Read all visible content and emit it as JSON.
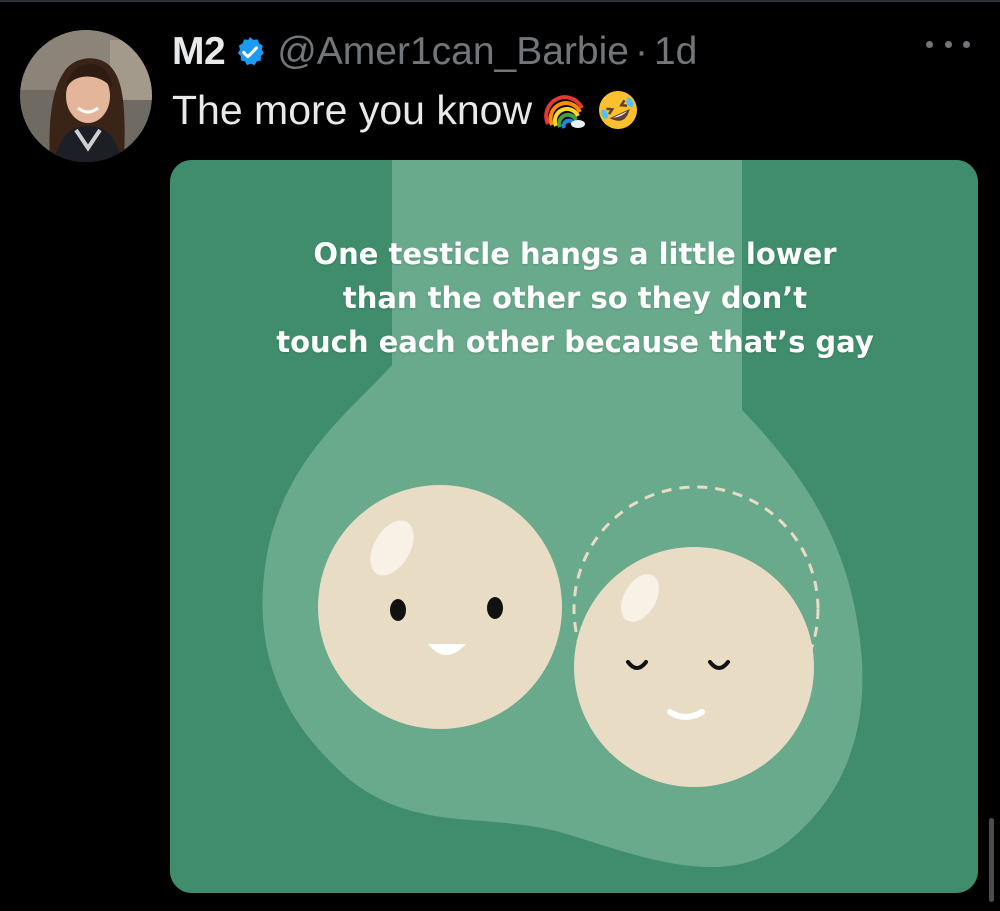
{
  "tweet": {
    "display_name": "M2",
    "handle": "@Amer1can_Barbie",
    "separator": "·",
    "time": "1d",
    "text": "The more you know",
    "emojis": [
      "rainbow-emoji",
      "rolling-laughing-emoji"
    ],
    "verified": true
  },
  "media": {
    "caption_lines": [
      "One testicle hangs a little lower",
      "than the other so they don’t",
      "touch each other because that’s gay"
    ]
  },
  "colors": {
    "background": "#000000",
    "text_primary": "#e7e9ea",
    "text_secondary": "#71767b",
    "verified_blue": "#1d9bf0",
    "media_green": "#3f8d6c",
    "media_shape_green": "#69a98c",
    "ball_fill": "#e8dcc4"
  }
}
